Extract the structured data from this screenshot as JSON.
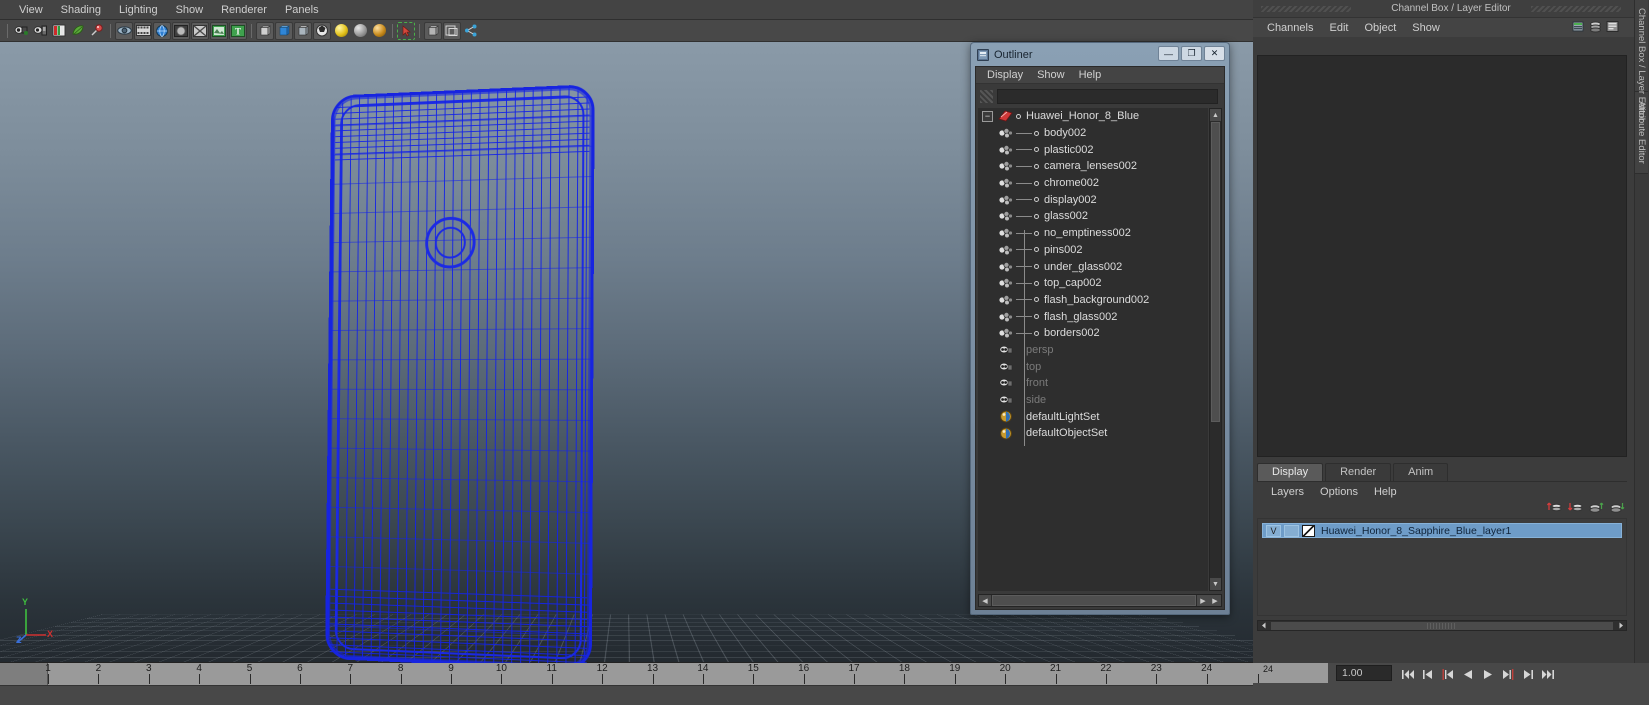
{
  "viewport_menu": [
    "View",
    "Shading",
    "Lighting",
    "Show",
    "Renderer",
    "Panels"
  ],
  "viewport_toolbar": [
    {
      "name": "select-camera-icon",
      "type": "cam"
    },
    {
      "name": "camera-attributes-icon",
      "type": "cam2"
    },
    {
      "name": "book-icon",
      "type": "book"
    },
    {
      "name": "grid-leaf-icon",
      "type": "leaf"
    },
    {
      "name": "pin-icon",
      "type": "pin"
    },
    {
      "sep": true
    },
    {
      "name": "two-sided-lighting-icon",
      "type": "eye"
    },
    {
      "name": "film-gate-icon",
      "type": "film"
    },
    {
      "name": "resolution-gate-icon",
      "type": "globe"
    },
    {
      "name": "gate-mask-icon",
      "type": "disc"
    },
    {
      "name": "xray-icon",
      "type": "xray"
    },
    {
      "name": "exposure-icon",
      "type": "grid"
    },
    {
      "name": "text-icon",
      "type": "text"
    },
    {
      "sep": true
    },
    {
      "name": "wireframe-shading-icon",
      "type": "wire"
    },
    {
      "name": "smooth-shade-icon",
      "type": "cube-blue"
    },
    {
      "name": "smooth-shade-all-icon",
      "type": "cube-grey"
    },
    {
      "name": "textured-icon",
      "type": "ball"
    },
    {
      "name": "use-default-light-icon",
      "type": "light-yellow"
    },
    {
      "name": "use-all-lights-icon",
      "type": "light-grey"
    },
    {
      "name": "shadows-icon",
      "type": "light-amber"
    },
    {
      "sep": true
    },
    {
      "name": "screenshot-selected-icon",
      "type": "marquee"
    },
    {
      "sep": true
    },
    {
      "name": "isolate-select-icon",
      "type": "cube-grey2"
    },
    {
      "name": "xray-joints-icon",
      "type": "frame"
    },
    {
      "name": "share-icon",
      "type": "share"
    }
  ],
  "outliner": {
    "title": "Outliner",
    "menu": [
      "Display",
      "Show",
      "Help"
    ],
    "search_value": "",
    "search_placeholder": "",
    "window_buttons": [
      {
        "name": "minimize-button",
        "glyph": "—"
      },
      {
        "name": "maximize-button",
        "glyph": "❐"
      },
      {
        "name": "close-button",
        "glyph": "✕"
      }
    ],
    "root": {
      "label": "Huawei_Honor_8_Blue",
      "expanded": true
    },
    "children": [
      "body002",
      "plastic002",
      "camera_lenses002",
      "chrome002",
      "display002",
      "glass002",
      "no_emptiness002",
      "pins002",
      "under_glass002",
      "top_cap002",
      "flash_background002",
      "flash_glass002",
      "borders002"
    ],
    "cameras": [
      "persp",
      "top",
      "front",
      "side"
    ],
    "sets": [
      "defaultLightSet",
      "defaultObjectSet"
    ]
  },
  "channel_box": {
    "title": "Channel Box / Layer Editor",
    "menu": [
      "Channels",
      "Edit",
      "Object",
      "Show"
    ],
    "icons": [
      "channel-box-icon",
      "layer-editor-icon",
      "attribute-editor-icon"
    ]
  },
  "layer_editor": {
    "tabs": [
      {
        "label": "Display",
        "active": true
      },
      {
        "label": "Render",
        "active": false
      },
      {
        "label": "Anim",
        "active": false
      }
    ],
    "menu": [
      "Layers",
      "Options",
      "Help"
    ],
    "tool_icons": [
      "new-layer-icon",
      "new-layer-from-selected-icon",
      "move-layer-up-icon",
      "move-layer-down-icon"
    ],
    "layers": [
      {
        "visibility": "V",
        "display_type": "",
        "name": "Huawei_Honor_8_Sapphire_Blue_layer1",
        "selected": true
      }
    ]
  },
  "right_vertical_tabs": [
    "Channel Box / Layer Editor",
    "Attribute Editor"
  ],
  "timeline": {
    "ticks": [
      1,
      2,
      3,
      4,
      5,
      6,
      7,
      8,
      9,
      10,
      11,
      12,
      13,
      14,
      15,
      16,
      17,
      18,
      19,
      20,
      21,
      22,
      23,
      24
    ],
    "current_frame": "1.00",
    "range_end_label": "24",
    "playback_buttons": [
      {
        "name": "go-to-start-button",
        "glyph": "|◀◀"
      },
      {
        "name": "step-back-keyframe-button",
        "glyph": "|◀"
      },
      {
        "name": "step-back-frame-button",
        "glyph": "◀|"
      },
      {
        "name": "play-backwards-button",
        "glyph": "◀"
      },
      {
        "name": "play-forwards-button",
        "glyph": "▶"
      },
      {
        "name": "step-forward-frame-button",
        "glyph": "|▶"
      },
      {
        "name": "step-forward-keyframe-button",
        "glyph": "▶|"
      },
      {
        "name": "go-to-end-button",
        "glyph": "▶▶|"
      }
    ]
  },
  "gizmo": {
    "y_label": "Y",
    "x_label": "X",
    "z_label": "Z",
    "y_color": "#3fbf3f",
    "x_color": "#d03030",
    "z_color": "#3a6fd8"
  },
  "colors": {
    "wireframe": "#1724e0",
    "selection": "#6e9cc8",
    "panel": "#3c3c3c"
  }
}
